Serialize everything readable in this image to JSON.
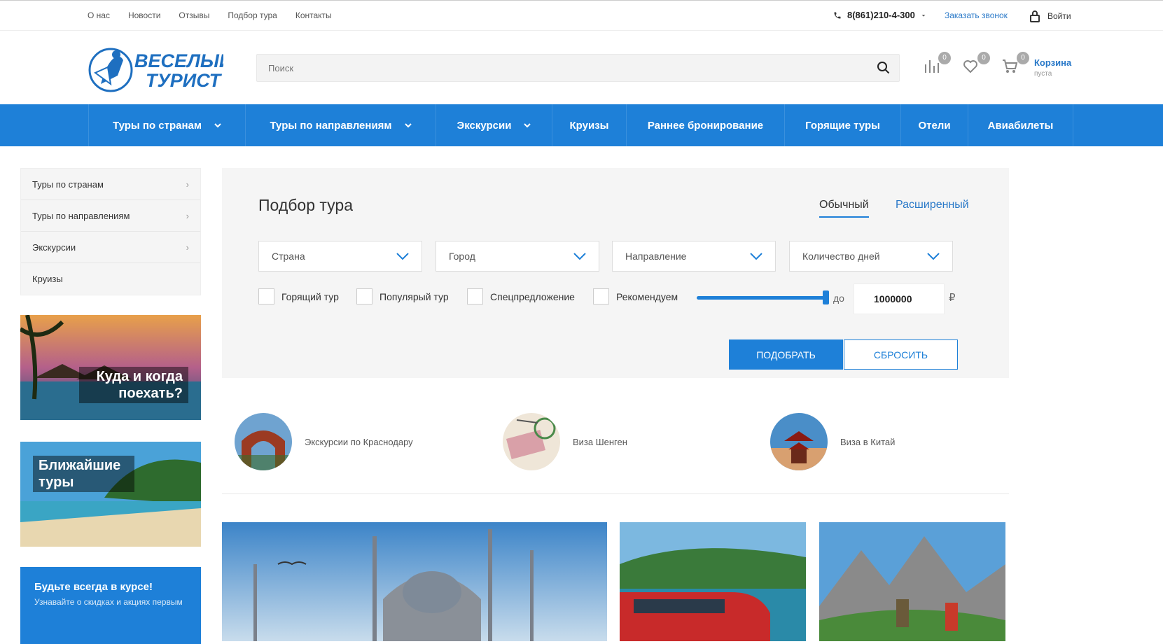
{
  "topbar": {
    "links": [
      "О нас",
      "Новости",
      "Отзывы",
      "Подбор тура",
      "Контакты"
    ],
    "phone": "8(861)210-4-300",
    "callback": "Заказать звонок",
    "login": "Войти"
  },
  "header": {
    "logo_line1": "ВЕСЕЛЫЙ",
    "logo_line2": "ТУРИСТ",
    "search_placeholder": "Поиск",
    "compare_count": "0",
    "favorites_count": "0",
    "cart_count": "0",
    "cart_title": "Корзина",
    "cart_status": "пуста"
  },
  "mainnav": {
    "items": [
      {
        "label": "Туры по странам",
        "dropdown": true
      },
      {
        "label": "Туры по направлениям",
        "dropdown": true
      },
      {
        "label": "Экскурсии",
        "dropdown": true
      },
      {
        "label": "Круизы",
        "dropdown": false
      },
      {
        "label": "Раннее бронирование",
        "dropdown": false
      },
      {
        "label": "Горящие туры",
        "dropdown": false
      },
      {
        "label": "Отели",
        "dropdown": false
      },
      {
        "label": "Авиабилеты",
        "dropdown": false
      }
    ]
  },
  "sidebar": {
    "items": [
      "Туры по странам",
      "Туры по направлениям",
      "Экскурсии",
      "Круизы"
    ],
    "banner1": "Куда и когда поехать?",
    "banner2": "Ближайшие туры",
    "subscribe_title": "Будьте всегда в курсе!",
    "subscribe_text": "Узнавайте о скидках и акциях первым"
  },
  "filter": {
    "title": "Подбор тура",
    "tab_normal": "Обычный",
    "tab_extended": "Расширенный",
    "selects": [
      "Страна",
      "Город",
      "Направление",
      "Количество дней"
    ],
    "checkboxes": [
      "Горящий тур",
      "Популярый тур",
      "Спецпредложение",
      "Рекомендуем"
    ],
    "price_to_label": "до",
    "price_max": "1000000",
    "currency": "₽",
    "price_fill": 1.0,
    "submit": "ПОДОБРАТЬ",
    "reset": "СБРОСИТЬ"
  },
  "quicklinks": [
    "Экскурсии по Краснодару",
    "Виза Шенген",
    "Виза в Китай"
  ],
  "colors": {
    "accent": "#1e80d8",
    "link": "#2878c8"
  }
}
